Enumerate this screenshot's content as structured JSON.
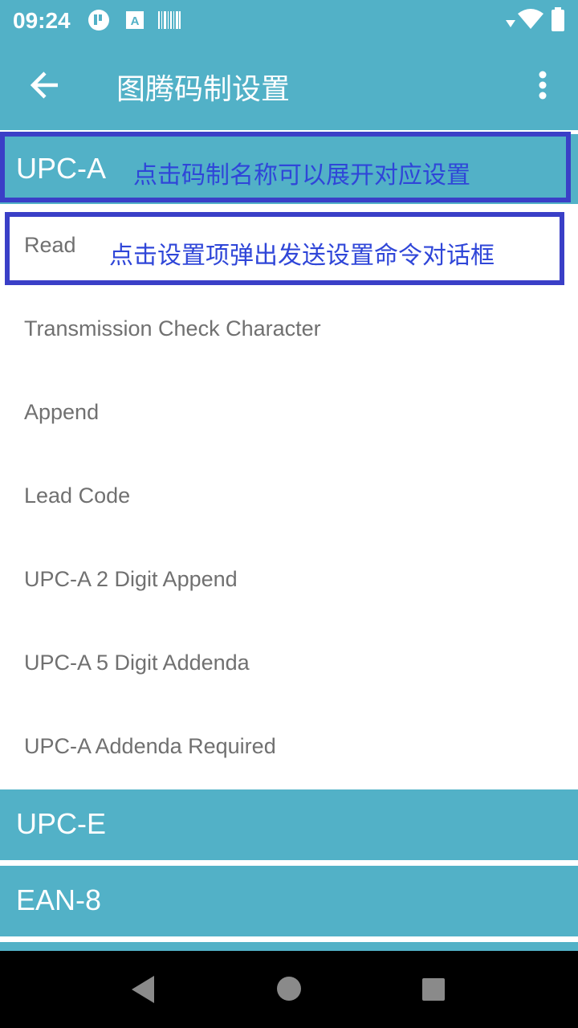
{
  "status_bar": {
    "time": "09:24",
    "left_icons": [
      "app-notification-icon",
      "text-a-icon",
      "barcode-icon"
    ],
    "right_icons": [
      "signal-arrow-icon",
      "wifi-icon",
      "battery-icon"
    ]
  },
  "app_bar": {
    "title": "图腾码制设置",
    "back_icon": "arrow-back-icon",
    "menu_icon": "more-vert-icon"
  },
  "groups": [
    {
      "label": "UPC-A",
      "expanded": true,
      "items": [
        "Read",
        "Transmission Check Character",
        "Append",
        "Lead Code",
        "UPC-A 2 Digit Append",
        "UPC-A 5 Digit Addenda",
        "UPC-A Addenda Required"
      ]
    },
    {
      "label": "UPC-E",
      "expanded": false
    },
    {
      "label": "EAN-8",
      "expanded": false
    }
  ],
  "annotations": {
    "header_hint": "点击码制名称可以展开对应设置",
    "item_hint": "点击设置项弹出发送设置命令对话框"
  },
  "colors": {
    "primary": "#52b1c7",
    "annotation": "#3a3fc7",
    "item_text": "#707070"
  },
  "nav_bar": {
    "icons": [
      "back-triangle-icon",
      "home-circle-icon",
      "recents-square-icon"
    ]
  }
}
